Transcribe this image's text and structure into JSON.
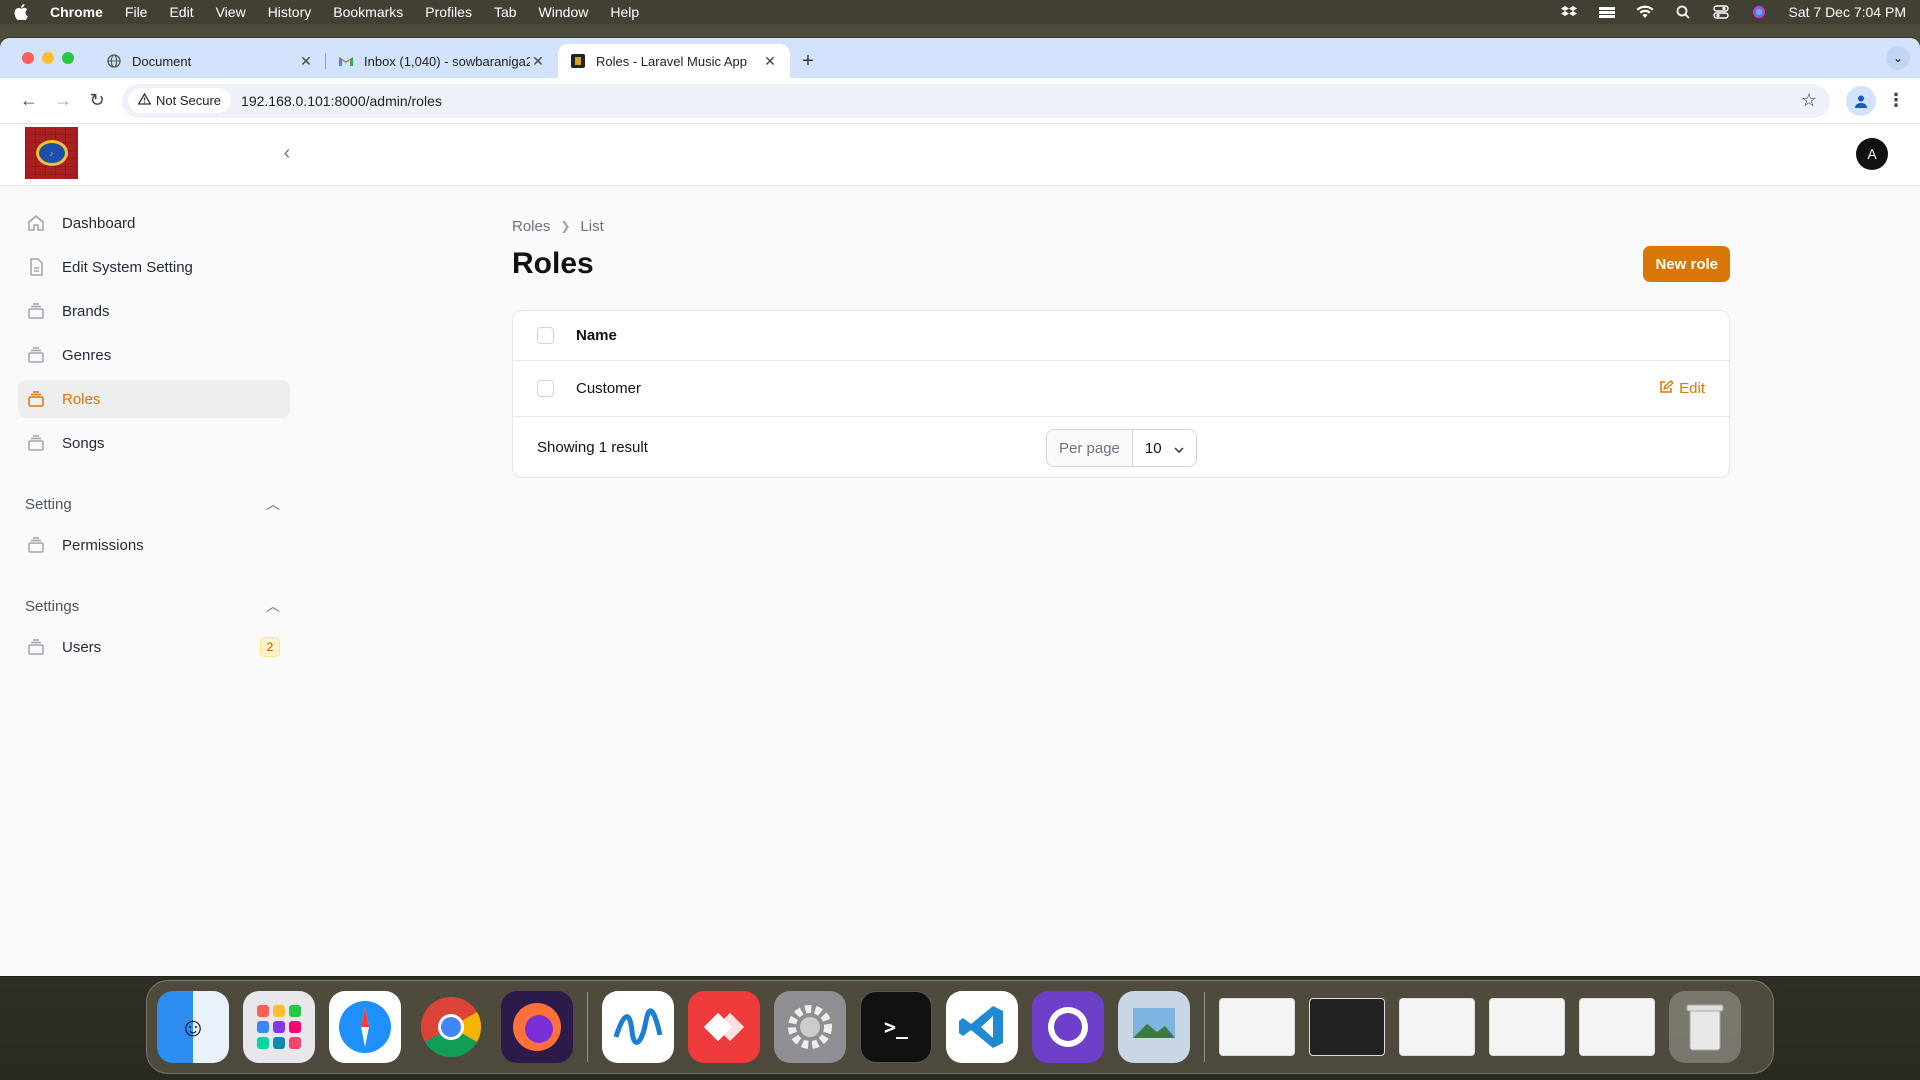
{
  "menubar": {
    "app_name": "Chrome",
    "items": [
      "File",
      "Edit",
      "View",
      "History",
      "Bookmarks",
      "Profiles",
      "Tab",
      "Window",
      "Help"
    ],
    "clock": "Sat 7 Dec  7:04 PM"
  },
  "browser": {
    "tabs": [
      {
        "title": "Document",
        "icon": "globe-icon"
      },
      {
        "title": "Inbox (1,040) - sowbaraniga2",
        "icon": "gmail-icon"
      },
      {
        "title": "Roles - Laravel Music App",
        "icon": "app-favicon"
      }
    ],
    "security_label": "Not Secure",
    "url": "192.168.0.101:8000/admin/roles"
  },
  "header": {
    "avatar_initial": "A"
  },
  "sidebar": {
    "items": [
      {
        "label": "Dashboard",
        "icon": "home-icon"
      },
      {
        "label": "Edit System Setting",
        "icon": "document-icon"
      },
      {
        "label": "Brands",
        "icon": "stack-icon"
      },
      {
        "label": "Genres",
        "icon": "stack-icon"
      },
      {
        "label": "Roles",
        "icon": "stack-icon",
        "active": true
      },
      {
        "label": "Songs",
        "icon": "stack-icon"
      }
    ],
    "groups": [
      {
        "label": "Setting",
        "items": [
          {
            "label": "Permissions",
            "icon": "stack-icon"
          }
        ]
      },
      {
        "label": "Settings",
        "items": [
          {
            "label": "Users",
            "icon": "stack-icon",
            "badge": "2"
          }
        ]
      }
    ]
  },
  "main": {
    "breadcrumb": [
      "Roles",
      "List"
    ],
    "title": "Roles",
    "new_button": "New role",
    "table": {
      "columns": [
        "Name"
      ],
      "rows": [
        {
          "name": "Customer",
          "action": "Edit"
        }
      ],
      "summary": "Showing 1 result",
      "per_page_label": "Per page",
      "per_page_value": "10"
    }
  },
  "colors": {
    "accent": "#d97706",
    "tabstrip": "#d3e3fd"
  }
}
